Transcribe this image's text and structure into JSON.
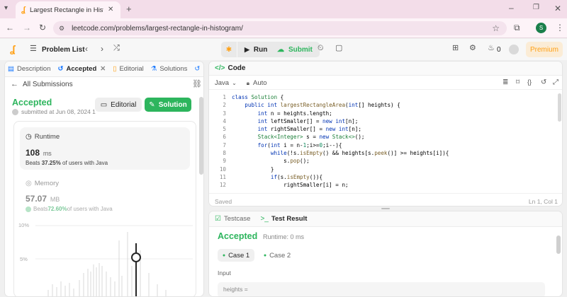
{
  "browser": {
    "tab_title": "Largest Rectangle in Histogram",
    "url": "leetcode.com/problems/largest-rectangle-in-histogram/",
    "profile_initial": "S"
  },
  "header": {
    "problem_list": "Problem List",
    "run": "Run",
    "submit": "Submit",
    "streak": "0",
    "premium": "Premium"
  },
  "left_tabs": [
    {
      "label": "Description"
    },
    {
      "label": "Accepted"
    },
    {
      "label": "Editorial"
    },
    {
      "label": "Solutions"
    }
  ],
  "submission": {
    "back_label": "All Submissions",
    "status": "Accepted",
    "submitted": "submitted at Jun 08, 2024 1",
    "editorial_btn": "Editorial",
    "solution_btn": "Solution",
    "runtime_title": "Runtime",
    "runtime_value": "108",
    "runtime_unit": "ms",
    "runtime_beats_prefix": "Beats ",
    "runtime_beats_pct": "37.25%",
    "runtime_beats_suffix": " of users with Java",
    "memory_title": "Memory",
    "memory_value": "57.07",
    "memory_unit": "MB",
    "memory_beats_prefix": "Beats ",
    "memory_beats_pct": "72.60%",
    "memory_beats_suffix": " of users with Java",
    "chart_label_10": "10%",
    "chart_label_5": "5%"
  },
  "code": {
    "title": "Code",
    "language": "Java",
    "auto": "Auto",
    "saved": "Saved",
    "cursor": "Ln 1, Col 1",
    "lines": [
      "class Solution {",
      "    public int largestRectangleArea(int[] heights) {",
      "        int n = heights.length;",
      "        int leftSmaller[] = new int[n];",
      "        int rightSmaller[] = new int[n];",
      "        Stack<Integer> s = new Stack<>();",
      "        for(int i = n-1;i>=0;i--){",
      "            while(!s.isEmpty() && heights[s.peek()] >= heights[i]){",
      "                s.pop();",
      "            }",
      "            if(s.isEmpty()){",
      "                rightSmaller[i] = n;"
    ],
    "line_numbers": [
      "1",
      "2",
      "3",
      "4",
      "5",
      "6",
      "7",
      "8",
      "9",
      "10",
      "11",
      "12"
    ]
  },
  "result": {
    "testcase_tab": "Testcase",
    "result_tab": "Test Result",
    "status": "Accepted",
    "runtime": "Runtime: 0 ms",
    "case1": "Case 1",
    "case2": "Case 2",
    "input_label": "Input",
    "input_value": "heights ="
  },
  "colors": {
    "accepted": "#2db55d",
    "accent": "#ffa116",
    "solution_btn": "#2db55d",
    "premium": "#ffa116"
  }
}
